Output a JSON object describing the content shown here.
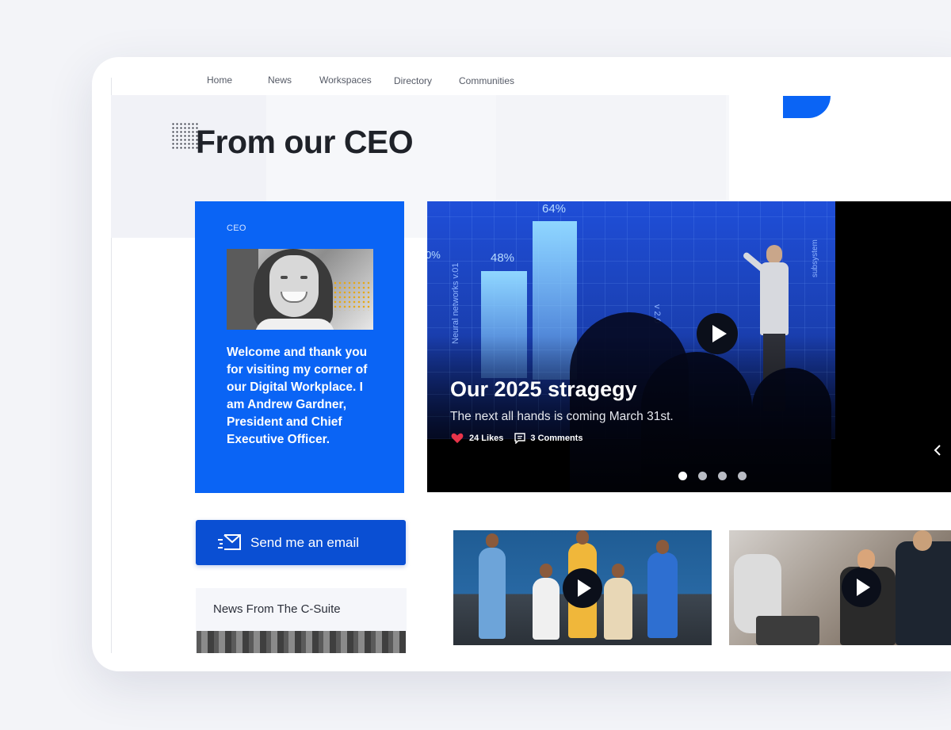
{
  "nav": {
    "items": [
      {
        "label": "Home"
      },
      {
        "label": "News"
      },
      {
        "label": "Workspaces"
      },
      {
        "label": "Directory"
      },
      {
        "label": "Communities"
      }
    ]
  },
  "page": {
    "title": "From our CEO"
  },
  "ceo_card": {
    "label": "CEO",
    "message": "Welcome and thank you for visiting my corner of our Digital Workplace.  I am Andrew Gardner, President and Chief Executive Officer."
  },
  "email_button": {
    "label": "Send me an email"
  },
  "news_box": {
    "title": "News From The C-Suite"
  },
  "hero": {
    "title": "Our 2025 stragegy",
    "subtitle": "The next all hands is coming March 31st.",
    "likes": "24 Likes",
    "comments": "3 Comments",
    "screen_labels": {
      "pct_left": "0%",
      "pct_bar1": "48%",
      "pct_bar2": "64%",
      "vert_label_1": "Neural networks v.01",
      "vert_label_2": "v 2.0",
      "vert_label_3": "subsystem"
    },
    "carousel": {
      "count": 4,
      "active": 0
    }
  },
  "colors": {
    "brand_blue": "#0a64f5",
    "button_blue": "#0a4fd3",
    "like_red": "#e8344a"
  },
  "icons": {
    "email_button": "mail-send-icon",
    "likes": "heart-icon",
    "comments": "comment-icon",
    "carousel_prev": "chevron-left-icon",
    "video": "play-icon"
  }
}
